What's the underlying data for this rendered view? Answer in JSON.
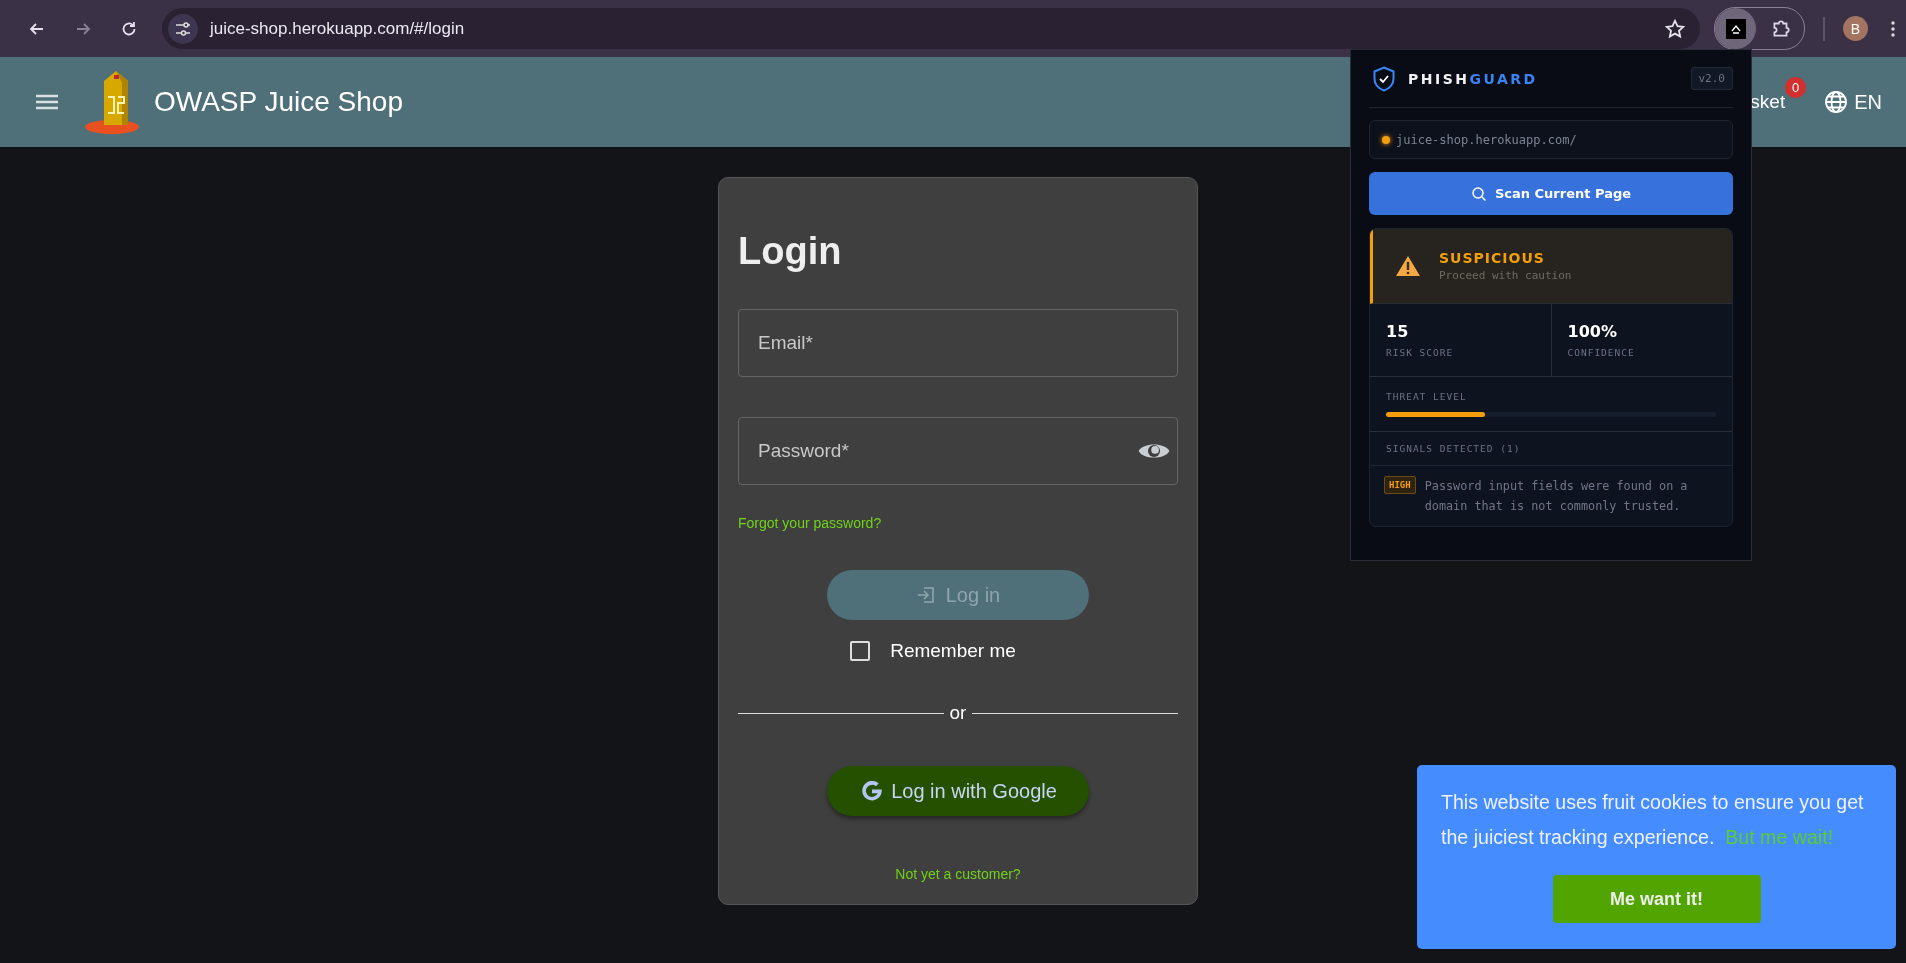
{
  "browser": {
    "back_enabled": true,
    "forward_enabled": false,
    "url": "juice-shop.herokuapp.com/#/login",
    "profile_initial": "B"
  },
  "header": {
    "title": "OWASP Juice Shop",
    "basket_label": "sket",
    "basket_count": "0",
    "language": "EN"
  },
  "login": {
    "title": "Login",
    "fields": [
      {
        "kind": "text",
        "label": "Email*"
      },
      {
        "kind": "password",
        "label": "Password*"
      }
    ],
    "forgot_link": "Forgot your password?",
    "login_button": {
      "label": "Log in",
      "disabled": true
    },
    "remember": {
      "label": "Remember me",
      "checked": false
    },
    "divider": "or",
    "google_button": "Log in with Google",
    "register_link": "Not yet a customer?"
  },
  "extension": {
    "brand_first": "PHISH",
    "brand_second": "GUARD",
    "version": "v2.0",
    "url": "juice-shop.herokuapp.com/",
    "scan_button": "Scan Current Page",
    "verdict": {
      "title": "SUSPICIOUS",
      "subtitle": "Proceed with caution",
      "kind": "suspicious"
    },
    "stats": [
      {
        "value": "15",
        "label": "RISK SCORE"
      },
      {
        "value": "100%",
        "label": "CONFIDENCE"
      }
    ],
    "threat": {
      "label": "THREAT LEVEL",
      "level": 0.3
    },
    "signals_title": "SIGNALS DETECTED (1)",
    "signals": [
      {
        "severity": "HIGH",
        "text": "Password input fields were found on a domain that is not commonly trusted."
      }
    ]
  },
  "cookie": {
    "text": "This website uses fruit cookies to ensure you get the juiciest tracking experience.",
    "link": "But me wait!",
    "button": "Me want it!"
  }
}
